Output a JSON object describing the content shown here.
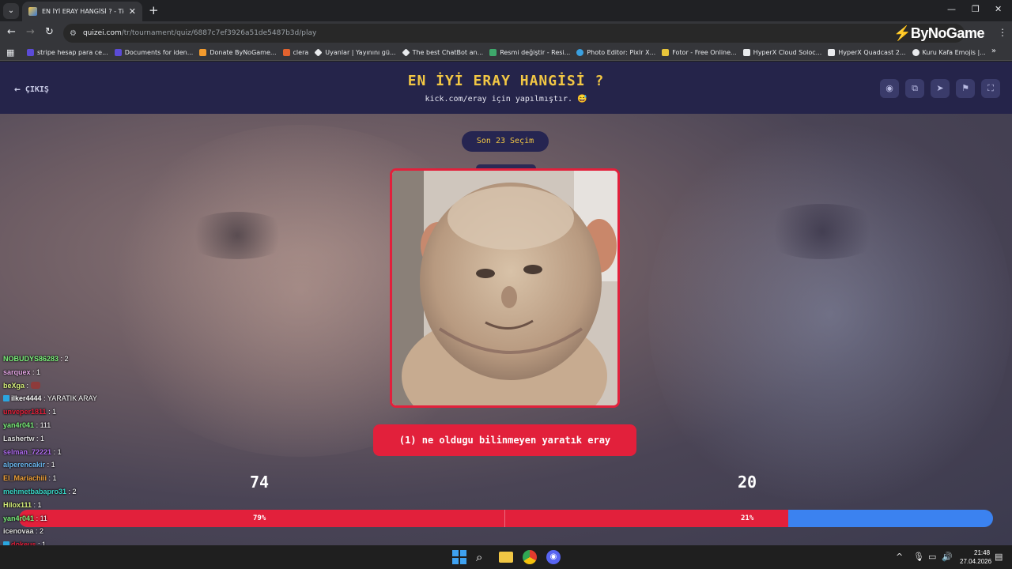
{
  "browser": {
    "tab_title": "EN İYİ ERAY HANGİSİ ? - Tier Lis",
    "url_host": "quizei.com",
    "url_path": "/tr/tournament/quiz/6887c7ef3926a51de5487b3d/play",
    "extension_brand": "ByNoGame",
    "bookmarks": [
      {
        "label": "stripe hesap para ce...",
        "color": "#5b4bd6"
      },
      {
        "label": "Documents for iden...",
        "color": "#5b4bd6"
      },
      {
        "label": "Donate ByNoGame...",
        "color": "#f29b2e"
      },
      {
        "label": "clera",
        "color": "#e2622e"
      },
      {
        "label": "Uyanlar | Yayınını gü...",
        "color": "#e8eaed"
      },
      {
        "label": "The best ChatBot an...",
        "color": "#e8eaed"
      },
      {
        "label": "Resmi değiştir - Resi...",
        "color": "#3ea86b"
      },
      {
        "label": "Photo Editor: Pixlr X...",
        "color": "#3aa0e0"
      },
      {
        "label": "Fotor - Free Online...",
        "color": "#e8c53a"
      },
      {
        "label": "HyperX Cloud Soloc...",
        "color": "#e8eaed"
      },
      {
        "label": "HyperX Quadcast 2...",
        "color": "#e8eaed"
      },
      {
        "label": "Kuru Kafa Emojis |...",
        "color": "#e8eaed"
      }
    ]
  },
  "quiz": {
    "exit_label": "ÇIKIŞ",
    "title": "EN İYİ ERAY HANGİSİ ?",
    "subtitle": "kick.com/eray için yapılmıştır. 😅",
    "recent_label": "Son 23 Seçim",
    "choice_label": "(1) ne oldugu bilinmeyen yaratık eray",
    "left_count": "74",
    "right_count": "20",
    "left_percent": "79%",
    "right_percent": "21%",
    "left_fraction": 0.79,
    "colors": {
      "accent": "#e2203b",
      "secondary": "#3b82f0",
      "title": "#f2c744",
      "header": "#25244a"
    }
  },
  "chat": [
    {
      "user": "NOBUDYS86283",
      "msg": ": 2",
      "color": "#7cf27c"
    },
    {
      "user": "sarquex",
      "msg": ": 1",
      "color": "#e8a8e8"
    },
    {
      "user": "beXga",
      "msg": ":",
      "color": "#d8f27c",
      "emote": true
    },
    {
      "user": "ilker4444",
      "msg": ": YARATIK ARAY",
      "color": "#ffffff",
      "badge": true
    },
    {
      "user": "unveper1811",
      "msg": ": 1",
      "color": "#e2203b"
    },
    {
      "user": "yan4r041",
      "msg": ": 111",
      "color": "#7cf27c"
    },
    {
      "user": "Lashertw",
      "msg": ": 1",
      "color": "#e0e0e0"
    },
    {
      "user": "selman_72221",
      "msg": ": 1",
      "color": "#b06cf0"
    },
    {
      "user": "alperencakir",
      "msg": ": 1",
      "color": "#6cb8f0"
    },
    {
      "user": "El_Mariachiii",
      "msg": ": 1",
      "color": "#f0a23a"
    },
    {
      "user": "mehmetbabapro31",
      "msg": ": 2",
      "color": "#3ad8c8"
    },
    {
      "user": "Hilox111",
      "msg": ": 1",
      "color": "#d8f27c"
    },
    {
      "user": "yan4r041",
      "msg": ": 11",
      "color": "#7cf27c"
    },
    {
      "user": "icenovaa",
      "msg": ": 2",
      "color": "#e0e0e0"
    },
    {
      "user": "dokeus",
      "msg": ": 1",
      "color": "#e2203b",
      "badge": true
    }
  ],
  "taskbar": {
    "time": "21:48",
    "date": "27.04.2026"
  }
}
